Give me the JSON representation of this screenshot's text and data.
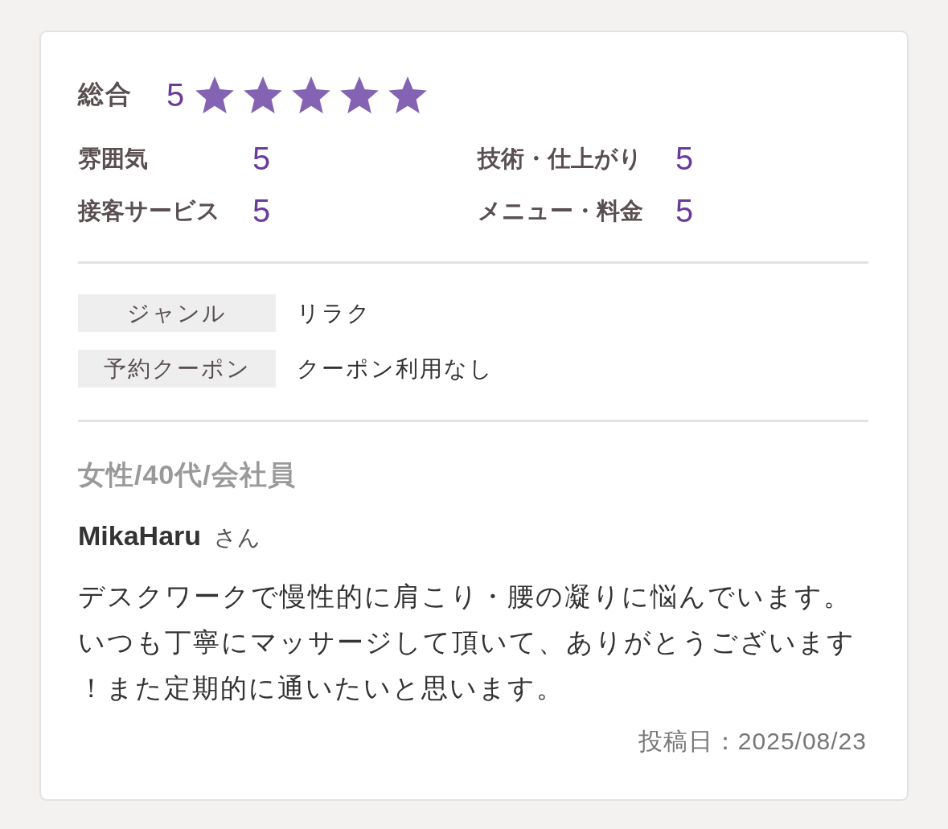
{
  "overall": {
    "label": "総合",
    "score": "5",
    "stars": 5
  },
  "ratings": [
    {
      "label": "雰囲気",
      "score": "5"
    },
    {
      "label": "技術・仕上がり",
      "score": "5"
    },
    {
      "label": "接客サービス",
      "score": "5"
    },
    {
      "label": "メニュー・料金",
      "score": "5"
    }
  ],
  "details": [
    {
      "label": "ジャンル",
      "value": "リラク"
    },
    {
      "label": "予約クーポン",
      "value": "クーポン利用なし"
    }
  ],
  "reviewer": {
    "profile": "女性/40代/会社員",
    "name": "MikaHaru",
    "honorific": "さん"
  },
  "comment": "デスクワークで慢性的に肩こり・腰の凝りに悩んでいます。いつも丁寧にマッサージして頂いて、ありがとうございます！また定期的に通いたいと思います。",
  "posted_date": "投稿日：2025/08/23"
}
